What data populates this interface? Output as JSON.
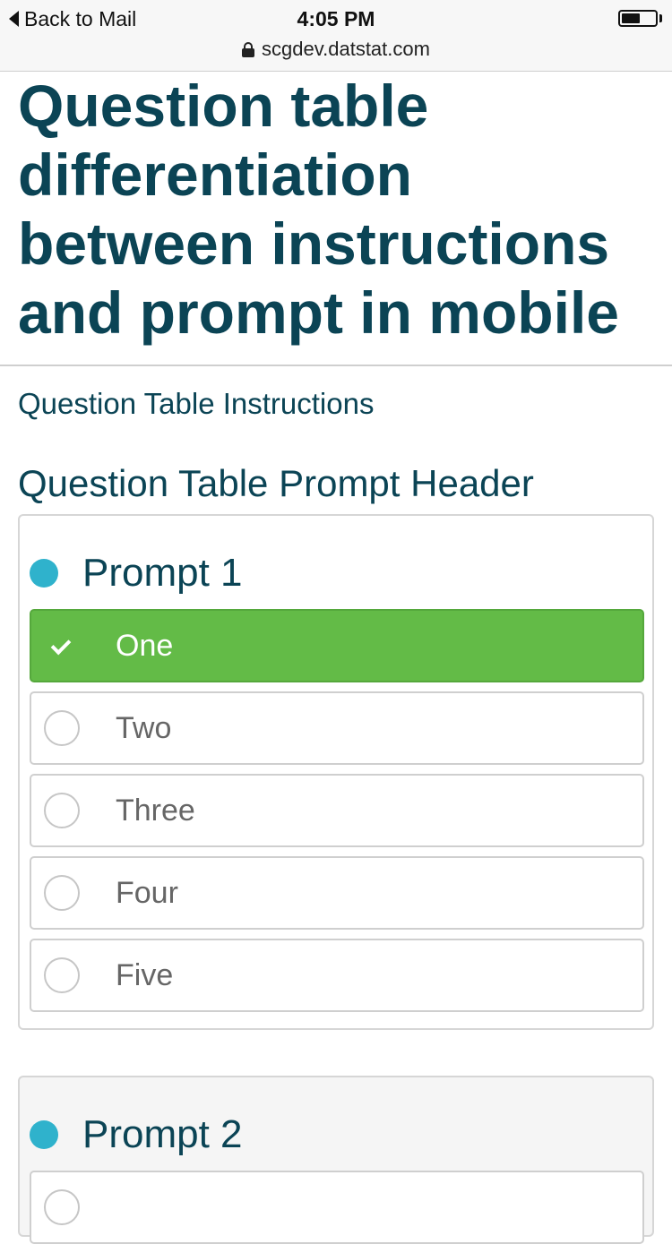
{
  "status_bar": {
    "back_label": "Back to Mail",
    "time": "4:05 PM",
    "url": "scgdev.datstat.com",
    "battery_level": 0.55
  },
  "page": {
    "title": "Question table differentiation between instructions and prompt in mobile",
    "instructions": "Question Table Instructions",
    "prompt_header": "Question Table Prompt Header"
  },
  "prompts": [
    {
      "label": "Prompt 1",
      "options": [
        {
          "label": "One",
          "selected": true
        },
        {
          "label": "Two",
          "selected": false
        },
        {
          "label": "Three",
          "selected": false
        },
        {
          "label": "Four",
          "selected": false
        },
        {
          "label": "Five",
          "selected": false
        }
      ]
    },
    {
      "label": "Prompt 2",
      "options": []
    }
  ],
  "colors": {
    "heading": "#0b4455",
    "prompt_dot": "#2fb2cc",
    "selected_option": "#63bb47",
    "option_text": "#666666"
  }
}
